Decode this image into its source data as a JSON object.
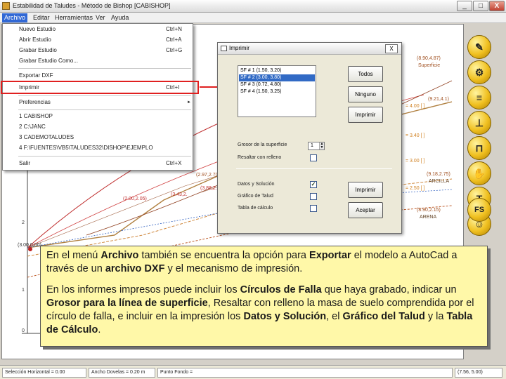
{
  "window": {
    "title": "Estabilidad de Taludes - Método de Bishop [CABISHOP]",
    "buttons": [
      "_",
      "□",
      "X"
    ]
  },
  "menubar": {
    "items": [
      "Archivo",
      "Editar",
      "Herramientas",
      "Ver",
      "Ayuda"
    ]
  },
  "file_menu": {
    "items": [
      {
        "label": "Nuevo Estudio",
        "shortcut": "Ctrl+N"
      },
      {
        "label": "Abrir Estudio",
        "shortcut": "Ctrl+A"
      },
      {
        "label": "Grabar Estudio",
        "shortcut": "Ctrl+G"
      },
      {
        "label": "Grabar Estudio Como...",
        "shortcut": ""
      },
      {
        "label": "Exportar DXF",
        "shortcut": ""
      },
      {
        "label": "Imprimir",
        "shortcut": "Ctrl+I"
      },
      {
        "label": "Preferencias",
        "shortcut": ""
      },
      {
        "label": "1 CABISHOP",
        "shortcut": ""
      },
      {
        "label": "2 C:\\JANC",
        "shortcut": ""
      },
      {
        "label": "3 CADEMOTALUDES",
        "shortcut": ""
      },
      {
        "label": "4 F:\\FUENTES\\VB5\\TALUDES32\\DISHOP\\EJEMPLO",
        "shortcut": ""
      },
      {
        "label": "Salir",
        "shortcut": "Ctrl+X"
      }
    ]
  },
  "print_dialog": {
    "title": "Imprimir",
    "close": "X",
    "surfaces": [
      "SF # 1 (1.50, 3.20)",
      "SF # 2 (3.00, 3.80)",
      "SF # 3 (0.72, 4.80)",
      "SF # 4 (1.50, 3.25)"
    ],
    "buttons": [
      "Todos",
      "Ninguno",
      "Imprimir",
      "Imprimir",
      "Aceptar"
    ],
    "grosor_label": "Grosor de la superficie",
    "grosor_value": "1",
    "relleno_label": "Resaltar con relleno",
    "datos_label": "Datos y Solución",
    "grafico_label": "Gráfico de Talud",
    "tabla_label": "Tabla de cálculo"
  },
  "canvas": {
    "labels": [
      "(8.90,4.87)",
      "Superficie",
      "(9.21,4.1)",
      "= 4.00 [ ]",
      "= 3.40 [ ]",
      "= 3.00 [ ]",
      "(9.18,2.75)",
      "ARCILLA",
      "= 2.50 [ ]",
      "(8.90,2.15)",
      "ARENA",
      "(2.97,2.70)",
      "(3.88,2.",
      "(3.43,2.",
      "(2.00,2.05)",
      "(3.00,0.00)",
      "2",
      "1",
      "0"
    ]
  },
  "tools": [
    "✎",
    "⚙",
    "≡",
    "⊥",
    "⊓",
    "✋",
    "T",
    "☺",
    "FS"
  ],
  "status": {
    "cells": [
      "Selección Horizontal = 0.00",
      "Ancho Dovelas = 0.20 m",
      "Punto Fondo =",
      "(7.56, 5.00)"
    ]
  },
  "callout": {
    "p1": [
      {
        "t": "En el menú "
      },
      {
        "t": "Archivo",
        "b": true
      },
      {
        "t": " también se encuentra la opción para "
      },
      {
        "t": "Exportar",
        "b": true
      },
      {
        "t": " el modelo a AutoCad a través de un "
      },
      {
        "t": "archivo DXF",
        "b": true
      },
      {
        "t": " y el mecanismo de impresión."
      }
    ],
    "p2": [
      {
        "t": "En los informes impresos puede incluir los "
      },
      {
        "t": "Círculos de Falla",
        "b": true
      },
      {
        "t": " que haya grabado, indicar un "
      },
      {
        "t": "Grosor para la línea de superficie",
        "b": true
      },
      {
        "t": ", Resaltar con relleno la masa de suelo comprendida por el círculo de falla, e incluir en la impresión los "
      },
      {
        "t": "Datos y Solución",
        "b": true
      },
      {
        "t": ", el "
      },
      {
        "t": "Gráfico del Talud",
        "b": true
      },
      {
        "t": " y la "
      },
      {
        "t": "Tabla de Cálculo",
        "b": true
      },
      {
        "t": "."
      }
    ]
  }
}
